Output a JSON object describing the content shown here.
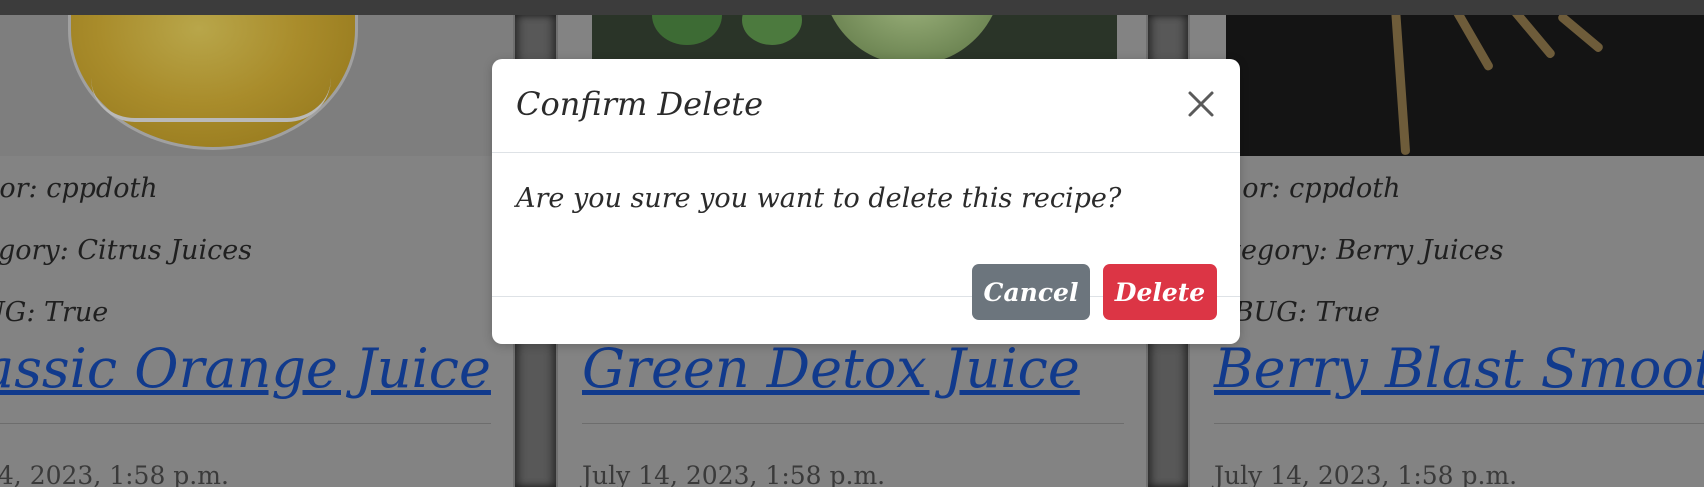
{
  "modal": {
    "title": "Confirm Delete",
    "message": "Are you sure you want to delete this recipe?",
    "cancel_label": "Cancel",
    "delete_label": "Delete",
    "close_icon": "close-icon"
  },
  "cards": [
    {
      "author": "hor: cppdoth",
      "category": "egory: Citrus Juices",
      "debug": "UG: True",
      "title": "assic Orange Juice",
      "date": "14, 2023, 1:58 p.m."
    },
    {
      "title": "Green Detox Juice",
      "date": "July 14, 2023, 1:58 p.m."
    },
    {
      "author": "thor: cppdoth",
      "category": "ategory: Berry Juices",
      "debug": "EBUG: True",
      "title": "Berry Blast Smoothie",
      "date": "July 14, 2023, 1:58 p.m."
    }
  ],
  "colors": {
    "overlay": "#8a8a8a",
    "link": "#113a8c",
    "cancel": "#6c757d",
    "delete": "#dc3545"
  }
}
